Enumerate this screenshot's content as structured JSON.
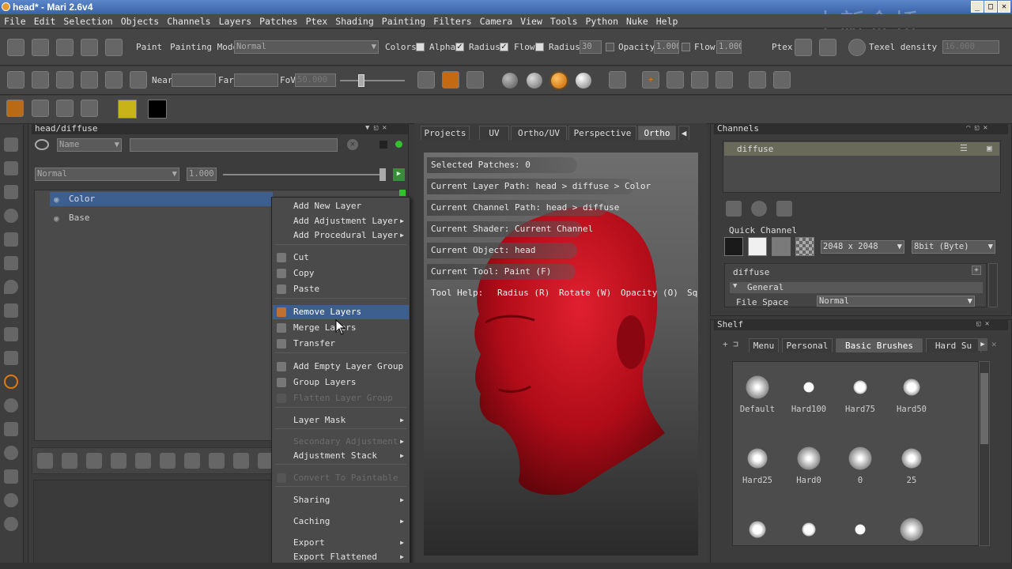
{
  "window": {
    "title": "head* - Mari 2.6v4",
    "watermark": "中新金桥"
  },
  "menu": [
    "File",
    "Edit",
    "Selection",
    "Objects",
    "Channels",
    "Layers",
    "Patches",
    "Ptex",
    "Shading",
    "Painting",
    "Filters",
    "Camera",
    "View",
    "Tools",
    "Python",
    "Nuke",
    "Help"
  ],
  "toolbar1": {
    "paint_label": "Paint",
    "painting_mode_label": "Painting Mode",
    "painting_mode_value": "Normal",
    "colors_label": "Colors",
    "alpha_label": "Alpha",
    "radius_check_label": "Radius",
    "flow_check_label": "Flow",
    "radius_label": "Radius",
    "radius_value": "30",
    "opacity_label": "Opacity",
    "opacity_value": "1.000",
    "flow_label": "Flow",
    "flow_value": "1.000",
    "ptex_label": "Ptex",
    "texel_label": "Texel density :",
    "texel_value": "16.000"
  },
  "toolbar2": {
    "near_label": "Near",
    "far_label": "Far",
    "fov_label": "FoV",
    "fov_value": "50.000"
  },
  "colors": {
    "accent": "#e07a10",
    "fg_swatch": "#c8b418",
    "bg_swatch": "#000000",
    "model": "#c0101e",
    "highlight": "#3d5f8f"
  },
  "layers_panel": {
    "title": "head/diffuse",
    "filter_field": "Name",
    "blend_mode": "Normal",
    "opacity": "1.000",
    "layers": [
      {
        "name": "Color",
        "selected": true
      },
      {
        "name": "Base",
        "selected": false
      }
    ]
  },
  "context_menu": {
    "items": [
      {
        "label": "Add New Layer",
        "sub": false,
        "disabled": false
      },
      {
        "label": "Add Adjustment Layer",
        "sub": true,
        "disabled": false
      },
      {
        "label": "Add Procedural Layer",
        "sub": true,
        "disabled": false
      },
      {
        "label": "Cut",
        "sub": false,
        "disabled": false
      },
      {
        "label": "Copy",
        "sub": false,
        "disabled": false
      },
      {
        "label": "Paste",
        "sub": false,
        "disabled": false
      },
      {
        "label": "Remove Layers",
        "sub": false,
        "disabled": false,
        "highlighted": true
      },
      {
        "label": "Merge Layers",
        "sub": false,
        "disabled": false
      },
      {
        "label": "Transfer",
        "sub": false,
        "disabled": false
      },
      {
        "label": "Add Empty Layer Group",
        "sub": false,
        "disabled": false
      },
      {
        "label": "Group Layers",
        "sub": false,
        "disabled": false
      },
      {
        "label": "Flatten Layer Group",
        "sub": false,
        "disabled": true
      },
      {
        "label": "Layer Mask",
        "sub": true,
        "disabled": false
      },
      {
        "label": "Secondary Adjustment",
        "sub": true,
        "disabled": true
      },
      {
        "label": "Adjustment Stack",
        "sub": true,
        "disabled": false
      },
      {
        "label": "Convert To Paintable",
        "sub": false,
        "disabled": true
      },
      {
        "label": "Sharing",
        "sub": true,
        "disabled": false
      },
      {
        "label": "Caching",
        "sub": true,
        "disabled": false
      },
      {
        "label": "Export",
        "sub": true,
        "disabled": false
      },
      {
        "label": "Export Flattened",
        "sub": true,
        "disabled": false
      }
    ]
  },
  "viewport": {
    "tabs": [
      "Projects",
      "UV",
      "Ortho/UV",
      "Perspective",
      "Ortho"
    ],
    "active_tab": "Ortho",
    "info": [
      "Selected Patches: 0",
      "Current Layer Path: head > diffuse > Color",
      "Current Channel Path: head > diffuse",
      "Current Shader: Current Channel",
      "Current Object: head",
      "Current Tool: Paint (F)"
    ],
    "tool_help": {
      "label": "Tool Help:",
      "radius": "Radius (R)",
      "rotate": "Rotate (W)",
      "opacity": "Opacity (O)",
      "more": "Sq"
    }
  },
  "channels_panel": {
    "title": "Channels",
    "channel": "diffuse",
    "quick_channel_label": "Quick Channel",
    "size": "2048 x 2048",
    "depth": "8bit (Byte)",
    "prop_title": "diffuse",
    "group": "General",
    "file_space_label": "File Space",
    "file_space_value": "Normal"
  },
  "shelf": {
    "title": "Shelf",
    "tabs": [
      "Menu",
      "Personal",
      "Basic Brushes",
      "Hard Su"
    ],
    "active_tab": "Basic Brushes",
    "brushes": [
      {
        "label": "Default",
        "soft": 1.0
      },
      {
        "label": "Hard100",
        "soft": 0.0
      },
      {
        "label": "Hard75",
        "soft": 0.25
      },
      {
        "label": "Hard50",
        "soft": 0.5
      },
      {
        "label": "Hard25",
        "soft": 0.75
      },
      {
        "label": "Hard0",
        "soft": 1.0
      },
      {
        "label": "0",
        "soft": 1.0
      },
      {
        "label": "25",
        "soft": 0.75
      },
      {
        "label": "",
        "soft": 0.5
      },
      {
        "label": "",
        "soft": 0.25
      },
      {
        "label": "",
        "soft": 0.0
      },
      {
        "label": "",
        "soft": 1.0
      }
    ]
  }
}
